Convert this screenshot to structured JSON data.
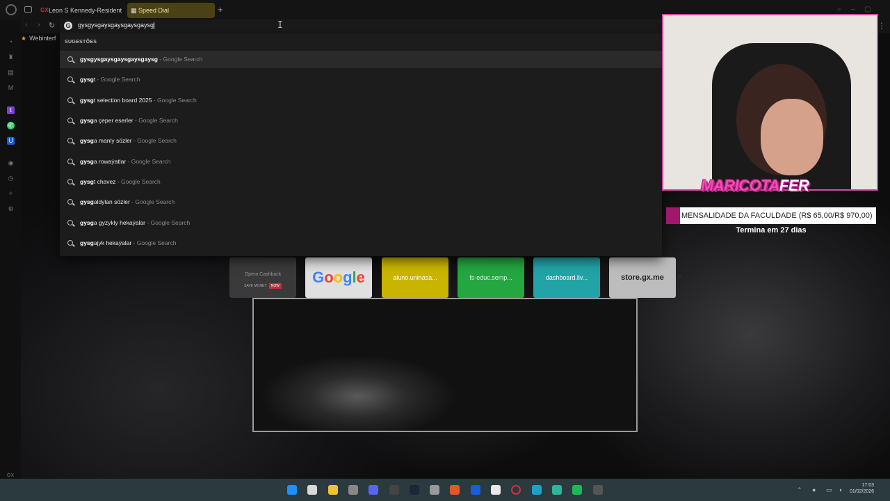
{
  "browser": {
    "tabs": [
      {
        "favicon": "GX",
        "label": "Leon S Kennedy-Resident"
      },
      {
        "favicon": "speed-dial-grid",
        "label": "Speed Dial"
      }
    ],
    "new_tab": "+",
    "address_text": "gysgysgaysgaysgaysgaysg",
    "address_icon": "G",
    "bookmark": "Webinterf",
    "menu": "⋮"
  },
  "suggestions": {
    "header": "SUGESTÕES",
    "items": [
      {
        "bold": "gysgysgaysgaysgaysgaysg",
        "rest": "",
        "source": " - Google Search"
      },
      {
        "bold": "gysg",
        "rest": "t",
        "source": " - Google Search"
      },
      {
        "bold": "gysg",
        "rest": "t selection board 2025",
        "source": " - Google Search"
      },
      {
        "bold": "gysg",
        "rest": "a çeper eserler",
        "source": " - Google Search"
      },
      {
        "bold": "gysg",
        "rest": "a manly sözler",
        "source": " - Google Search"
      },
      {
        "bold": "gysg",
        "rest": "a rowaýatlar",
        "source": " - Google Search"
      },
      {
        "bold": "gysg",
        "rest": "t chavez",
        "source": " - Google Search"
      },
      {
        "bold": "gysg",
        "rest": "aldylan sözler",
        "source": " - Google Search"
      },
      {
        "bold": "gysg",
        "rest": "a gyzykly hekaýalar",
        "source": " - Google Search"
      },
      {
        "bold": "gysg",
        "rest": "ajyk hekaýalar",
        "source": " - Google Search"
      }
    ]
  },
  "speed_dial": {
    "opera_tile": {
      "brand": "Opera Cashback",
      "tag": "SAVE MONEY",
      "now": "NOW"
    },
    "google_tile": {
      "g1": "G",
      "g2": "o",
      "g3": "o",
      "g4": "g",
      "g5": "l",
      "g6": "e"
    },
    "tiles": [
      "aluno.uninasa...",
      "fs-educ.semp...",
      "dashboard.liv...",
      "store.gx.me"
    ]
  },
  "overlay": {
    "logo_part1": "MA",
    "logo_part2": "RICOTA",
    "logo_part3": "FER",
    "goal_label": "MENSALIDADE DA FACULDADE (R$ 65,00/R$ 970,00)",
    "goal_progress": 0.067,
    "goal_days": "Termina em 27 dias"
  },
  "sidebar": {
    "gx_label": "GX",
    "more": "⋯"
  },
  "taskbar": {
    "clock_time": "17:03",
    "clock_date": "01/02/2026",
    "apps": [
      "windows-start-icon",
      "file-icon",
      "folder-icon",
      "app-icon",
      "discord-icon",
      "epic-games-icon",
      "steam-icon",
      "obs-icon",
      "brave-icon",
      "bitwarden-icon",
      "chrome-icon",
      "opera-gx-icon",
      "edge-icon",
      "app-icon",
      "spotify-icon",
      "settings-icon"
    ]
  },
  "colors": {
    "accent_tab": "#4a4214",
    "goal_bar": "#a0186e",
    "cam_border": "#d84aa0",
    "taskbar": "#2b3a3f"
  }
}
